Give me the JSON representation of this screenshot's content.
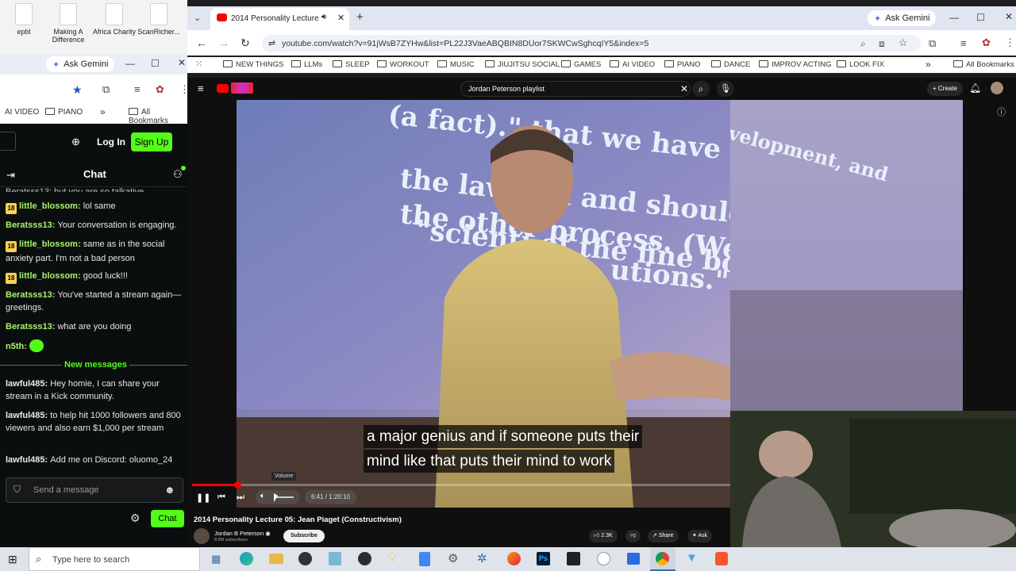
{
  "desktop": {
    "icons": [
      "epbl",
      "Making A Difference",
      "Africa Charity",
      "ScanRicher..."
    ]
  },
  "left_browser": {
    "gemini_label": "Ask Gemini",
    "bookmarks": [
      "AI VIDEO",
      "PIANO",
      "All Bookmarks"
    ]
  },
  "kick": {
    "login_label": "Log In",
    "signup_label": "Sign Up",
    "chat_title": "Chat",
    "cutoff_line": "Beratsss13: but you are so talkative",
    "messages": [
      {
        "badge": "18",
        "user": "little_blossom",
        "text": "lol same"
      },
      {
        "badge": "",
        "user": "Beratsss13",
        "text": "Your conversation is engaging."
      },
      {
        "badge": "18",
        "user": "little_blossom",
        "text": "same as in the social anxiety part. I'm not a bad person"
      },
      {
        "badge": "18",
        "user": "little_blossom",
        "text": "good luck!!!"
      },
      {
        "badge": "",
        "user": "Beratsss13",
        "text": "You've started a stream again—greetings."
      },
      {
        "badge": "",
        "user": "Beratsss13",
        "text": "what are you doing"
      },
      {
        "badge": "",
        "user": "n5th",
        "text": ""
      }
    ],
    "new_messages_label": "New messages",
    "new_messages": [
      {
        "user": "lawful485",
        "text": "Hey homie, I can share your stream in a Kick community."
      },
      {
        "user": "lawful485",
        "text": "to help hit 1000 followers and 800 viewers and also earn $1,000 per stream"
      },
      {
        "user": "lawful485",
        "text": "Add me on Discord: oluomo_24"
      }
    ],
    "input_placeholder": "Send a message",
    "send_label": "Chat",
    "colors": {
      "accent": "#53fc18"
    }
  },
  "main_browser": {
    "tab_title": "2014 Personality Lecture 05: Jean Piaget (Constructivism)",
    "gemini_label": "Ask Gemini",
    "url": "youtube.com/watch?v=91jWsB7ZYHw&list=PL22J3VaeABQBIN8DUor7SKWCwSghcqIY5&index=5",
    "bookmarks": [
      "NEW THINGS",
      "LLMs",
      "SLEEP",
      "WORKOUT",
      "MUSIC",
      "JIUJITSU SOCIAL",
      "GAMES",
      "AI VIDEO",
      "PIANO",
      "DANCE",
      "IMPROV ACTING",
      "LOOK FIX",
      "All Bookmarks"
    ]
  },
  "youtube": {
    "search_value": "Jordan Peterson playlist",
    "create_label": "Create",
    "slide_text": [
      "(a fact).\" that we have the right to state \"It is",
      "the law   can and should then seek is",
      "the other   process. (We are well aware, on",
      "\"scienti   of the fine book by Kuhn on",
      "utions.\" ...",
      "of this development, and"
    ],
    "caption_lines": [
      "a major genius and if someone puts their",
      "mind like that puts their mind to work"
    ],
    "volume_tooltip": "Volume",
    "time_display": "6:41 / 1:20:10",
    "progress": 0.084,
    "video_title": "2014 Personality Lecture 05: Jean Piaget (Constructivism)",
    "channel": "Jordan B Peterson",
    "subscribers": "8.8M subscribers",
    "subscribe_label": "Subscribe",
    "likes": "2.3K",
    "share_label": "Share",
    "ask_label": "Ask"
  },
  "taskbar": {
    "search_placeholder": "Type here to search",
    "icons": [
      "windows-icon",
      "task-view-icon",
      "edge-icon",
      "file-explorer-icon",
      "obs-icon",
      "notepad-icon",
      "davinci-icon",
      "lightbulb-icon",
      "docs-icon",
      "settings-icon",
      "game-icon",
      "firefox-icon",
      "photoshop-icon",
      "capcut-icon",
      "messenger-icon",
      "window-icon",
      "chrome-icon",
      "vpn-icon",
      "brave-icon"
    ]
  }
}
